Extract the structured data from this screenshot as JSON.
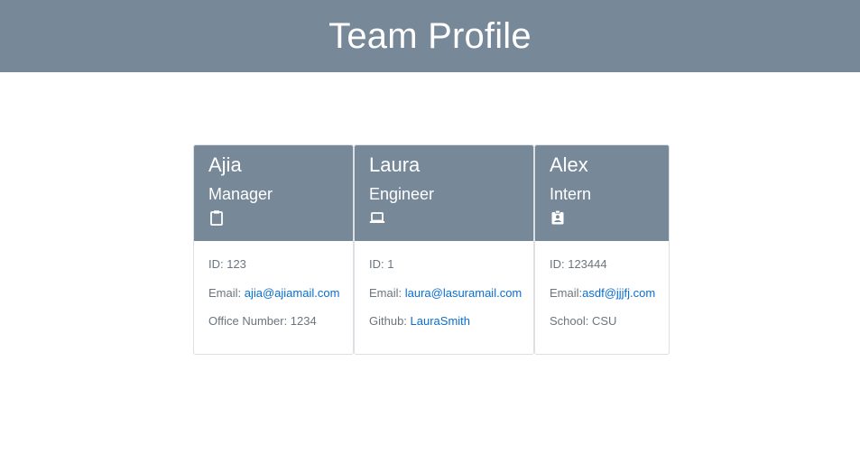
{
  "page": {
    "title": "Team Profile"
  },
  "colors": {
    "header_bg": "#778899",
    "link": "#0a6ed1",
    "muted_text": "#6c757d"
  },
  "cards": [
    {
      "name": "Ajia",
      "role": "Manager",
      "icon": "clipboard-icon",
      "id_label": "ID: 123",
      "email_prefix": "Email: ",
      "email": "ajia@ajiamail.com",
      "extra_label": "Office Number: 1234"
    },
    {
      "name": "Laura",
      "role": "Engineer",
      "icon": "laptop-icon",
      "id_label": "ID: 1",
      "email_prefix": "Email: ",
      "email": "laura@lasuramail.com",
      "extra_prefix": "Github: ",
      "extra_link": "LauraSmith"
    },
    {
      "name": "Alex",
      "role": "Intern",
      "icon": "id-badge-icon",
      "id_label": "ID: 123444",
      "email_prefix": "Email:",
      "email": "asdf@jjjfj.com",
      "extra_label": "School: CSU"
    }
  ]
}
